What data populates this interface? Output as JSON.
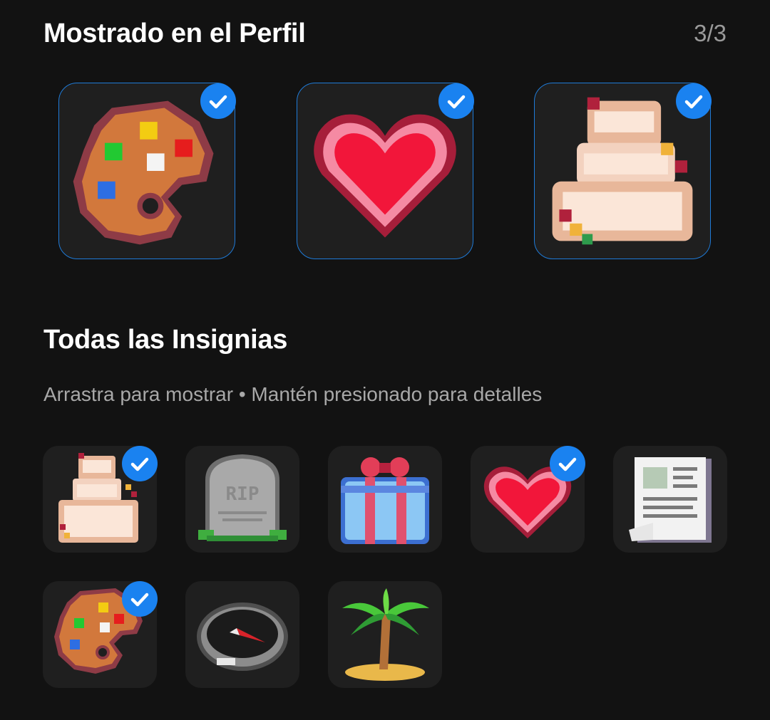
{
  "showcase": {
    "title": "Mostrado en el Perfil",
    "count": "3/3",
    "badges": [
      {
        "icon": "palette-icon",
        "selected": true
      },
      {
        "icon": "heart-icon",
        "selected": true
      },
      {
        "icon": "cake-icon",
        "selected": true
      }
    ]
  },
  "all_badges": {
    "title": "Todas las Insignias",
    "hint": "Arrastra para mostrar • Mantén presionado para detalles",
    "items": [
      {
        "icon": "cake-icon",
        "selected": true
      },
      {
        "icon": "tombstone-icon",
        "engraving": "RIP",
        "selected": false
      },
      {
        "icon": "gift-icon",
        "selected": false
      },
      {
        "icon": "heart-icon",
        "selected": true
      },
      {
        "icon": "newspaper-icon",
        "selected": false
      },
      {
        "icon": "palette-icon",
        "selected": true
      },
      {
        "icon": "compass-icon",
        "selected": false
      },
      {
        "icon": "palm-tree-icon",
        "selected": false
      }
    ]
  },
  "colors": {
    "background": "#121212",
    "tile": "#1f1f1f",
    "accent": "#1a82f0"
  }
}
